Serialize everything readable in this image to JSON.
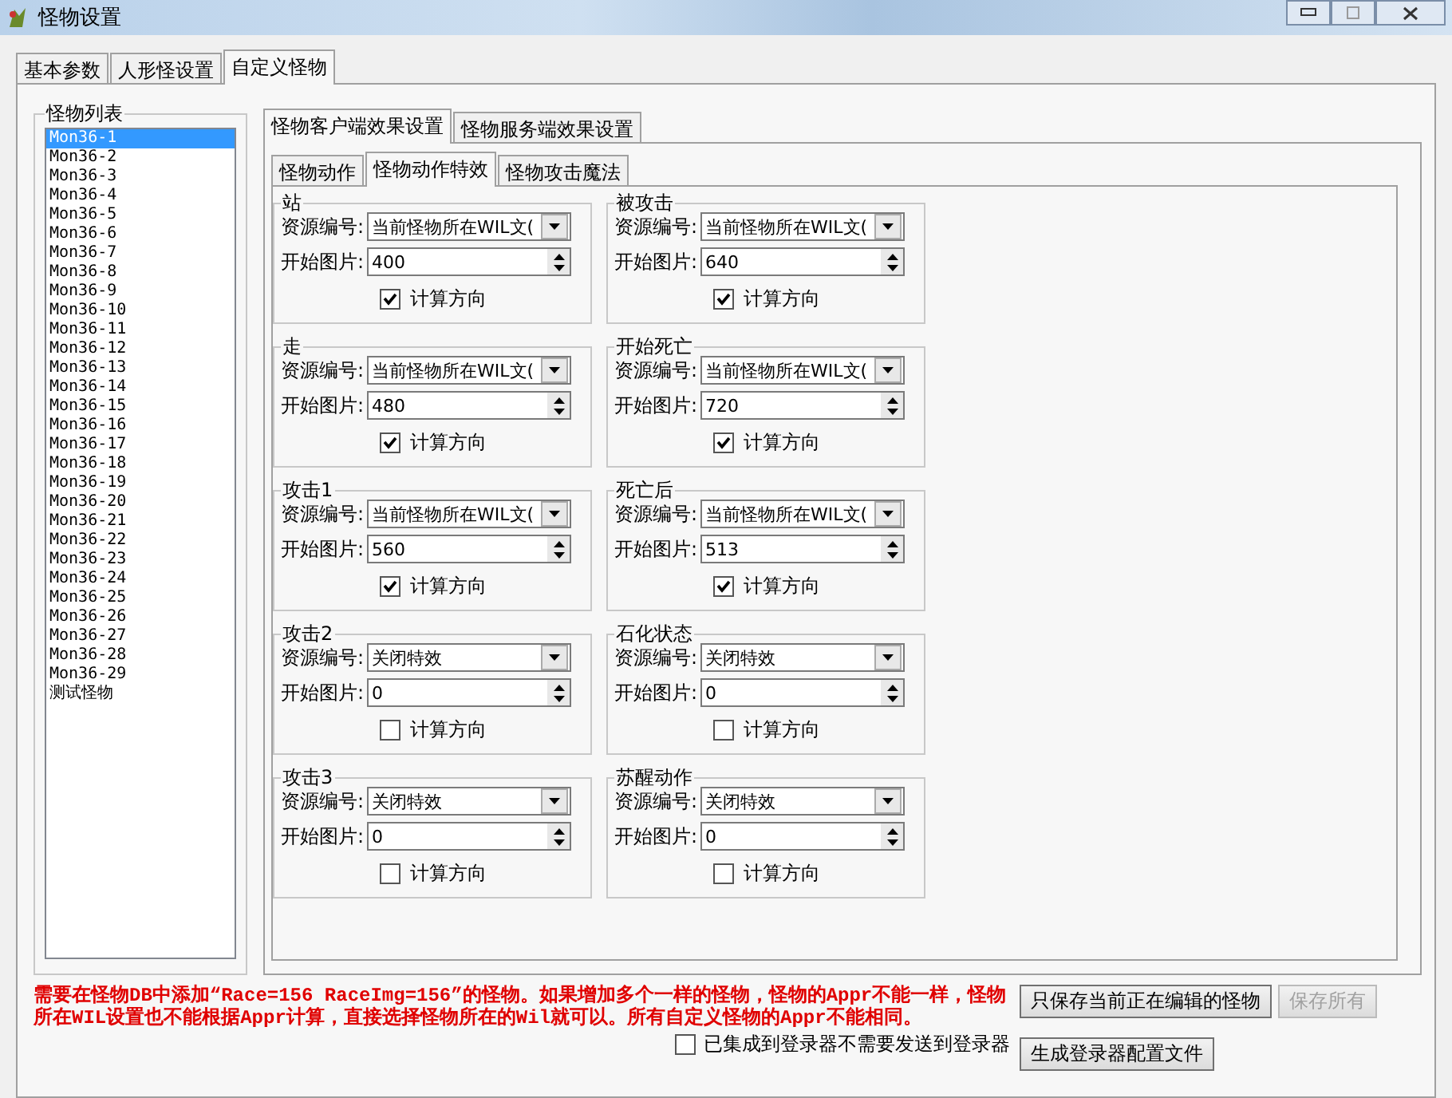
{
  "window": {
    "title": "怪物设置"
  },
  "outer_tabs": [
    {
      "label": "基本参数",
      "selected": false
    },
    {
      "label": "人形怪设置",
      "selected": false
    },
    {
      "label": "自定义怪物",
      "selected": true
    }
  ],
  "monster_list": {
    "title": "怪物列表",
    "items": [
      {
        "label": "Mon36-1",
        "selected": true
      },
      {
        "label": "Mon36-2",
        "selected": false
      },
      {
        "label": "Mon36-3",
        "selected": false
      },
      {
        "label": "Mon36-4",
        "selected": false
      },
      {
        "label": "Mon36-5",
        "selected": false
      },
      {
        "label": "Mon36-6",
        "selected": false
      },
      {
        "label": "Mon36-7",
        "selected": false
      },
      {
        "label": "Mon36-8",
        "selected": false
      },
      {
        "label": "Mon36-9",
        "selected": false
      },
      {
        "label": "Mon36-10",
        "selected": false
      },
      {
        "label": "Mon36-11",
        "selected": false
      },
      {
        "label": "Mon36-12",
        "selected": false
      },
      {
        "label": "Mon36-13",
        "selected": false
      },
      {
        "label": "Mon36-14",
        "selected": false
      },
      {
        "label": "Mon36-15",
        "selected": false
      },
      {
        "label": "Mon36-16",
        "selected": false
      },
      {
        "label": "Mon36-17",
        "selected": false
      },
      {
        "label": "Mon36-18",
        "selected": false
      },
      {
        "label": "Mon36-19",
        "selected": false
      },
      {
        "label": "Mon36-20",
        "selected": false
      },
      {
        "label": "Mon36-21",
        "selected": false
      },
      {
        "label": "Mon36-22",
        "selected": false
      },
      {
        "label": "Mon36-23",
        "selected": false
      },
      {
        "label": "Mon36-24",
        "selected": false
      },
      {
        "label": "Mon36-25",
        "selected": false
      },
      {
        "label": "Mon36-26",
        "selected": false
      },
      {
        "label": "Mon36-27",
        "selected": false
      },
      {
        "label": "Mon36-28",
        "selected": false
      },
      {
        "label": "Mon36-29",
        "selected": false
      },
      {
        "label": "测试怪物",
        "selected": false
      }
    ]
  },
  "client_tabs": [
    {
      "label": "怪物客户端效果设置",
      "selected": true
    },
    {
      "label": "怪物服务端效果设置",
      "selected": false
    }
  ],
  "action_tabs": [
    {
      "label": "怪物动作",
      "selected": false
    },
    {
      "label": "怪物动作特效",
      "selected": true
    },
    {
      "label": "怪物攻击魔法",
      "selected": false
    }
  ],
  "effect_groups": [
    {
      "title": "站",
      "resource_label": "资源编号:",
      "resource_value": "当前怪物所在WIL文(",
      "start_label": "开始图片:",
      "start_value": "400",
      "calc_label": "计算方向",
      "calc_checked": true
    },
    {
      "title": "被攻击",
      "resource_label": "资源编号:",
      "resource_value": "当前怪物所在WIL文(",
      "start_label": "开始图片:",
      "start_value": "640",
      "calc_label": "计算方向",
      "calc_checked": true
    },
    {
      "title": "走",
      "resource_label": "资源编号:",
      "resource_value": "当前怪物所在WIL文(",
      "start_label": "开始图片:",
      "start_value": "480",
      "calc_label": "计算方向",
      "calc_checked": true
    },
    {
      "title": "开始死亡",
      "resource_label": "资源编号:",
      "resource_value": "当前怪物所在WIL文(",
      "start_label": "开始图片:",
      "start_value": "720",
      "calc_label": "计算方向",
      "calc_checked": true
    },
    {
      "title": "攻击1",
      "resource_label": "资源编号:",
      "resource_value": "当前怪物所在WIL文(",
      "start_label": "开始图片:",
      "start_value": "560",
      "calc_label": "计算方向",
      "calc_checked": true
    },
    {
      "title": "死亡后",
      "resource_label": "资源编号:",
      "resource_value": "当前怪物所在WIL文(",
      "start_label": "开始图片:",
      "start_value": "513",
      "calc_label": "计算方向",
      "calc_checked": true
    },
    {
      "title": "攻击2",
      "resource_label": "资源编号:",
      "resource_value": "关闭特效",
      "start_label": "开始图片:",
      "start_value": "0",
      "calc_label": "计算方向",
      "calc_checked": false
    },
    {
      "title": "石化状态",
      "resource_label": "资源编号:",
      "resource_value": "关闭特效",
      "start_label": "开始图片:",
      "start_value": "0",
      "calc_label": "计算方向",
      "calc_checked": false
    },
    {
      "title": "攻击3",
      "resource_label": "资源编号:",
      "resource_value": "关闭特效",
      "start_label": "开始图片:",
      "start_value": "0",
      "calc_label": "计算方向",
      "calc_checked": false
    },
    {
      "title": "苏醒动作",
      "resource_label": "资源编号:",
      "resource_value": "关闭特效",
      "start_label": "开始图片:",
      "start_value": "0",
      "calc_label": "计算方向",
      "calc_checked": false
    }
  ],
  "notice": "需要在怪物DB中添加“Race=156 RaceImg=156”的怪物。如果增加多个一样的怪物，怪物的Appr不能一样，怪物所在WIL设置也不能根据Appr计算，直接选择怪物所在的Wil就可以。所有自定义怪物的Appr不能相同。",
  "buttons": [
    {
      "label": "只保存当前正在编辑的怪物",
      "disabled": false
    },
    {
      "label": "保存所有",
      "disabled": true
    }
  ],
  "integrate_checkbox": {
    "label": "已集成到登录器不需要发送到登录器",
    "checked": false
  },
  "generate_button": {
    "label": "生成登录器配置文件",
    "disabled": false
  }
}
